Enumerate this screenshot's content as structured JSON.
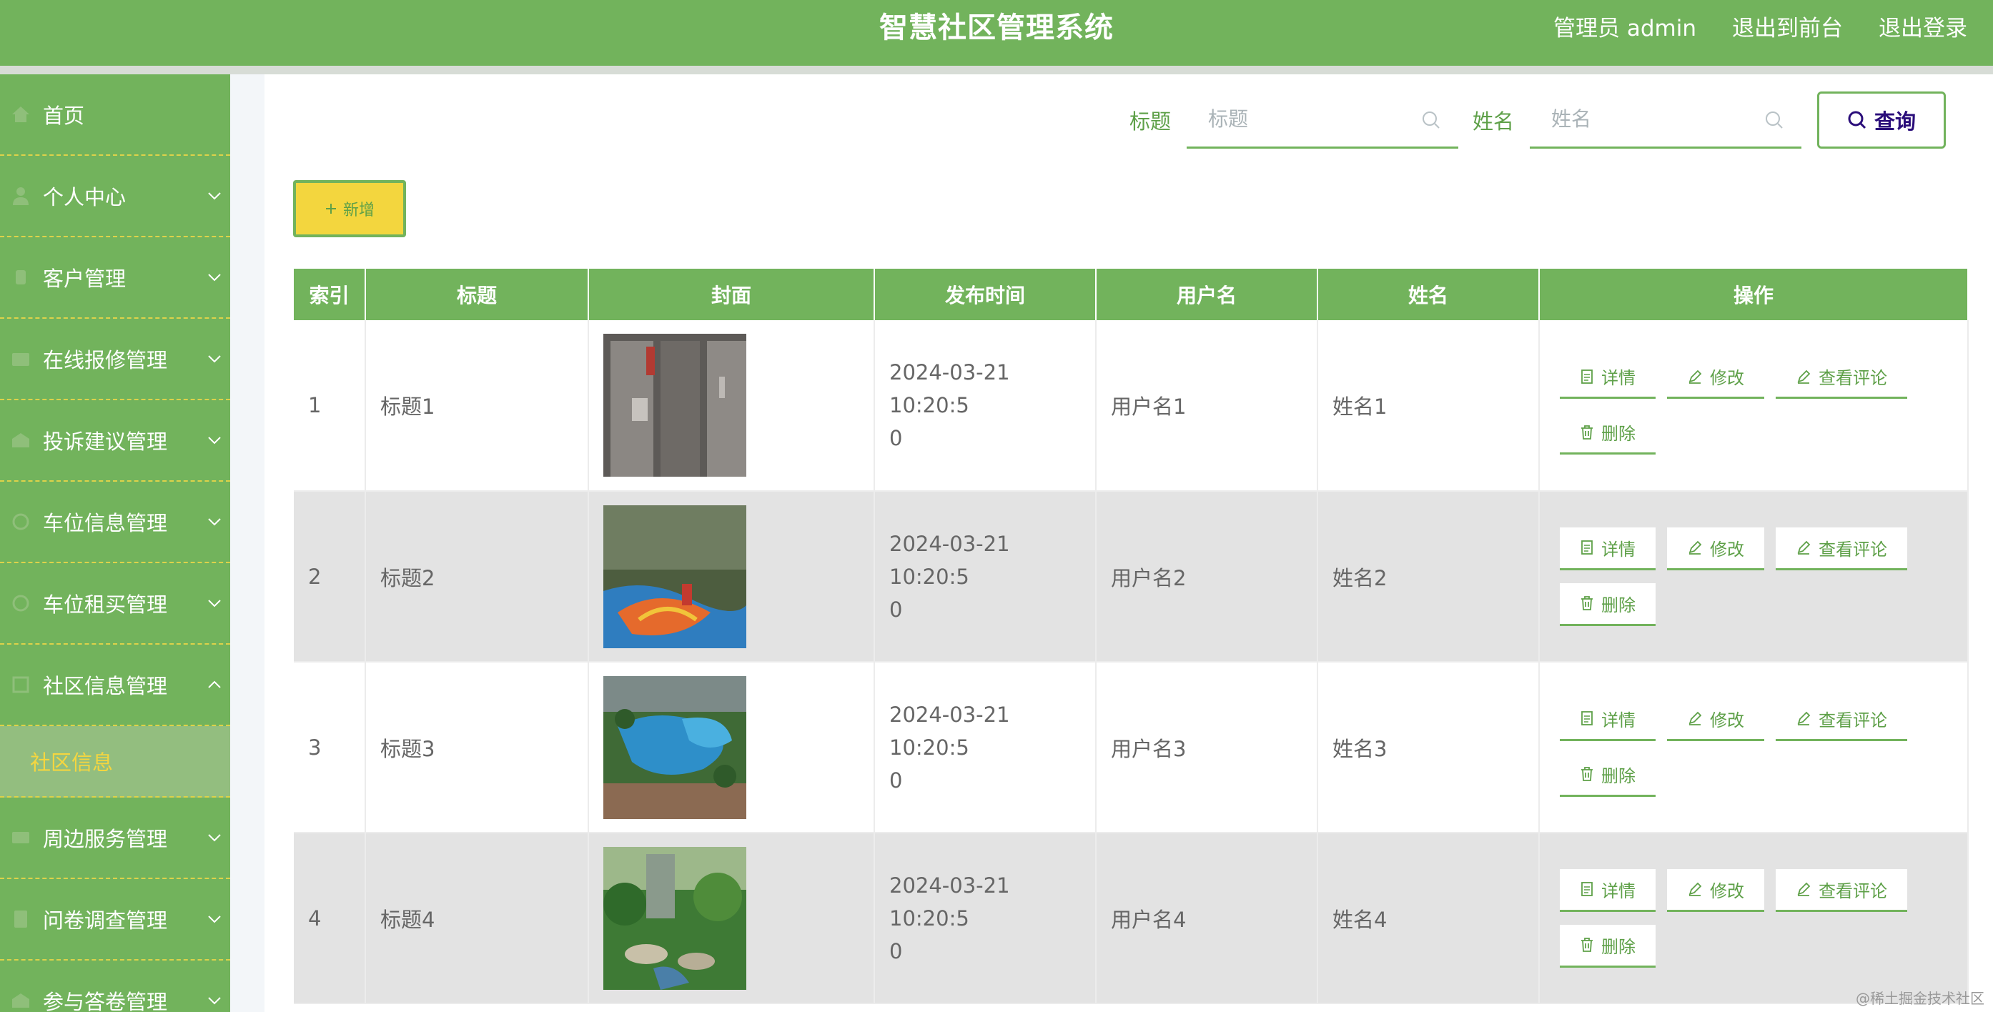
{
  "header": {
    "title": "智慧社区管理系统",
    "admin_label": "管理员 admin",
    "to_front_label": "退出到前台",
    "logout_label": "退出登录"
  },
  "sidebar": {
    "items": [
      {
        "label": "首页",
        "icon": "home-icon"
      },
      {
        "label": "个人中心",
        "icon": "user-icon"
      },
      {
        "label": "客户管理",
        "icon": "customer-icon"
      },
      {
        "label": "在线报修管理",
        "icon": "repair-icon"
      },
      {
        "label": "投诉建议管理",
        "icon": "complaint-icon"
      },
      {
        "label": "车位信息管理",
        "icon": "parking-icon"
      },
      {
        "label": "车位租买管理",
        "icon": "parking-rent-icon"
      },
      {
        "label": "社区信息管理",
        "icon": "community-icon"
      },
      {
        "label": "周边服务管理",
        "icon": "service-icon"
      },
      {
        "label": "问卷调查管理",
        "icon": "survey-icon"
      },
      {
        "label": "参与答卷管理",
        "icon": "answer-icon"
      }
    ],
    "active_sub": "社区信息"
  },
  "search": {
    "title_label": "标题",
    "title_placeholder": "标题",
    "name_label": "姓名",
    "name_placeholder": "姓名",
    "query_label": "查询"
  },
  "toolbar": {
    "add_label": "新增"
  },
  "table": {
    "headers": [
      "索引",
      "标题",
      "封面",
      "发布时间",
      "用户名",
      "姓名",
      "操作"
    ],
    "rows": [
      {
        "index": "1",
        "title": "标题1",
        "time_line1": "2024-03-21 10:20:5",
        "time_line2": "0",
        "username": "用户名1",
        "name": "姓名1"
      },
      {
        "index": "2",
        "title": "标题2",
        "time_line1": "2024-03-21 10:20:5",
        "time_line2": "0",
        "username": "用户名2",
        "name": "姓名2"
      },
      {
        "index": "3",
        "title": "标题3",
        "time_line1": "2024-03-21 10:20:5",
        "time_line2": "0",
        "username": "用户名3",
        "name": "姓名3"
      },
      {
        "index": "4",
        "title": "标题4",
        "time_line1": "2024-03-21 10:20:5",
        "time_line2": "0",
        "username": "用户名4",
        "name": "姓名4"
      }
    ],
    "actions": {
      "detail": "详情",
      "edit": "修改",
      "comments": "查看评论",
      "delete": "删除"
    }
  },
  "watermark": "@稀土掘金技术社区",
  "colors": {
    "primary": "#72b35c",
    "accent_yellow": "#f3d63e",
    "link_green": "#5ea048"
  }
}
